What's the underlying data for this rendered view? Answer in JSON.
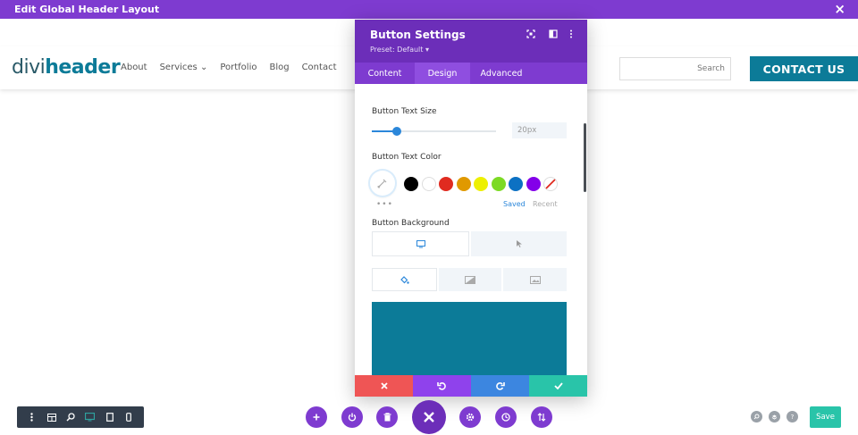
{
  "topbar": {
    "title": "Edit Global Header Layout",
    "close_icon": "×"
  },
  "site": {
    "logo_a": "divi",
    "logo_b": "header",
    "nav": [
      "About",
      "Services",
      "Portfolio",
      "Blog",
      "Contact"
    ],
    "services_caret": "⌄",
    "search_placeholder": "Search",
    "cta": "CONTACT US"
  },
  "modal": {
    "title": "Button Settings",
    "preset": "Preset: Default ▾",
    "tabs": [
      "Content",
      "Design",
      "Advanced"
    ],
    "active_tab": "Design",
    "text_size_label": "Button Text Size",
    "text_size_value": "20px",
    "text_size_slider_level": 0.2,
    "text_color_label": "Button Text Color",
    "swatch_colors": [
      "#000000",
      "#ffffff",
      "#e02b20",
      "#e09900",
      "#edf000",
      "#7cda24",
      "#0c71c3",
      "#8300e9"
    ],
    "more_label": "•••",
    "saved_label": "Saved",
    "recent_label": "Recent",
    "background_label": "Button Background",
    "preview_color": "#0c7b98",
    "footer_colors": [
      "#ef5555",
      "#8f42ec",
      "#3c86e0",
      "#29c4a9"
    ]
  },
  "colors": {
    "accent": "#7e3bd0",
    "brand": "#0c7b98"
  },
  "bottombar": {
    "save_label": "Save"
  }
}
